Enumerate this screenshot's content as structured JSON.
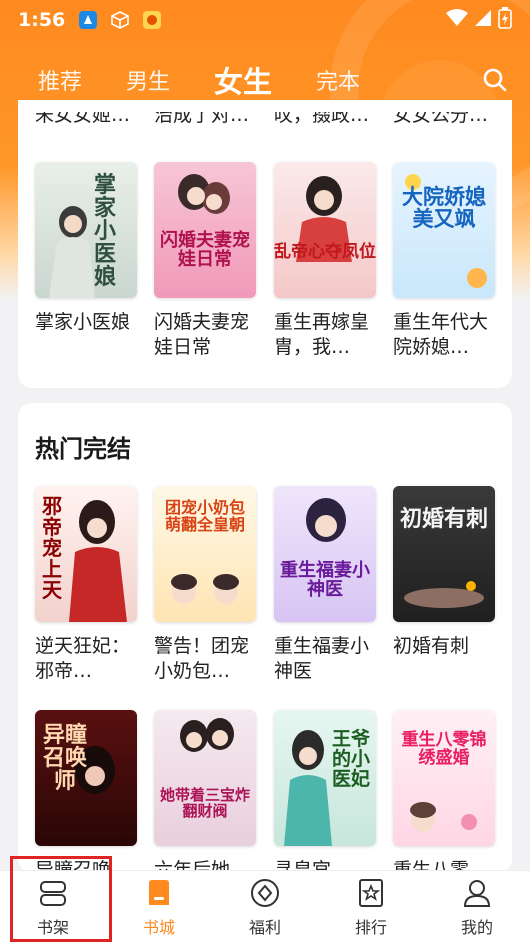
{
  "status_bar": {
    "time": "1:56",
    "icons": [
      "app-icon-blue",
      "box-icon",
      "app-icon-yellow",
      "wifi-icon",
      "signal-icon",
      "battery-icon"
    ]
  },
  "top_tabs": [
    {
      "label": "推荐",
      "active": false
    },
    {
      "label": "男生",
      "active": false
    },
    {
      "label": "女生",
      "active": true
    },
    {
      "label": "完本",
      "active": false
    }
  ],
  "section1": {
    "cut_titles": [
      "未女女姬…",
      "治成了对…",
      "叹，掇政…",
      "女女公分…"
    ],
    "books": [
      {
        "title": "掌家小医娘",
        "cover_text": "掌家小医娘"
      },
      {
        "title": "闪婚夫妻宠娃日常",
        "cover_text": "闪婚夫妻宠娃日常"
      },
      {
        "title": "重生再嫁皇胄，我…",
        "cover_text": "乱帝心夺凤位"
      },
      {
        "title": "重生年代大院娇媳…",
        "cover_text": "大院娇媳美又飒"
      }
    ]
  },
  "section2": {
    "title": "热门完结",
    "row1": [
      {
        "title": "逆天狂妃：邪帝…",
        "cover_text": "邪帝宠上天"
      },
      {
        "title": "警告！团宠小奶包…",
        "cover_text": "团宠小奶包萌翻全皇朝"
      },
      {
        "title": "重生福妻小神医",
        "cover_text": "重生福妻小神医"
      },
      {
        "title": "初婚有刺",
        "cover_text": "初婚有刺"
      }
    ],
    "row2": [
      {
        "title": "异瞳召唤…",
        "cover_text": "异瞳召唤师"
      },
      {
        "title": "六年后她…",
        "cover_text": "她带着三宝炸翻财阀"
      },
      {
        "title": "寻皇宫…",
        "cover_text": "王爷的小医妃"
      },
      {
        "title": "重生八零…",
        "cover_text": "重生八零锦绣盛婚"
      }
    ]
  },
  "bottom_nav": [
    {
      "label": "书架",
      "icon": "bookshelf-icon",
      "active": false
    },
    {
      "label": "书城",
      "icon": "bookstore-icon",
      "active": true
    },
    {
      "label": "福利",
      "icon": "welfare-icon",
      "active": false
    },
    {
      "label": "排行",
      "icon": "ranking-icon",
      "active": false
    },
    {
      "label": "我的",
      "icon": "profile-icon",
      "active": false
    }
  ],
  "colors": {
    "accent": "#ff8a1f",
    "highlight": "#e02424"
  }
}
